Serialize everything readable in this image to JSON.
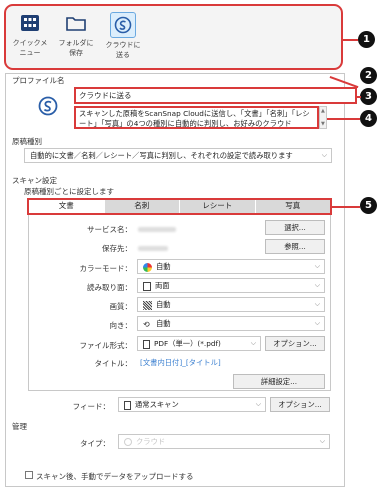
{
  "toolbar": {
    "buttons": [
      {
        "label_line1": "クイックメ",
        "label_line2": "ニュー",
        "icon": "grid-icon"
      },
      {
        "label_line1": "フォルダに",
        "label_line2": "保存",
        "icon": "folder-icon"
      },
      {
        "label_line1": "クラウドに",
        "label_line2": "送る",
        "icon": "scansnap-cloud-icon"
      }
    ]
  },
  "callouts": [
    "1",
    "2",
    "3",
    "4",
    "5"
  ],
  "profile": {
    "section_label": "プロファイル名",
    "name": "クラウドに送る",
    "description": "スキャンした原稿をScanSnap Cloudに送信し、「文書」「名刺」「レシート」「写真」の4つの種別に自動的に判別し、お好みのクラウド"
  },
  "doc_type": {
    "section_label": "原稿種別",
    "value": "自動的に文書／名刺／レシート／写真に判別し、それぞれの設定で読み取ります"
  },
  "scan_settings": {
    "section_label": "スキャン設定",
    "sub_label": "原稿種別ごとに設定します",
    "tabs": [
      "文書",
      "名刺",
      "レシート",
      "写真"
    ],
    "service_label": "サービス名：",
    "select_button": "選択...",
    "save_to_label": "保存先：",
    "browse_button": "参照...",
    "color_mode_label": "カラーモード：",
    "color_mode_value": "自動",
    "scan_side_label": "読み取り面：",
    "scan_side_value": "両面",
    "quality_label": "画質：",
    "quality_value": "自動",
    "orientation_label": "向き：",
    "orientation_value": "自動",
    "file_format_label": "ファイル形式：",
    "file_format_value": "PDF（単一）(*.pdf)",
    "options_button": "オプション...",
    "title_label": "タイトル：",
    "title_value": "[文書内日付]_[タイトル]",
    "detail_button": "詳細設定...",
    "feed_label": "フィード：",
    "feed_value": "通常スキャン",
    "feed_options_button": "オプション..."
  },
  "management": {
    "section_label": "管理",
    "type_label": "タイプ：",
    "type_value": "クラウド"
  },
  "upload_checkbox_label": "スキャン後、手動でデータをアップロードする",
  "colors": {
    "highlight": "#d93a3a",
    "accent": "#3a7fd0"
  }
}
